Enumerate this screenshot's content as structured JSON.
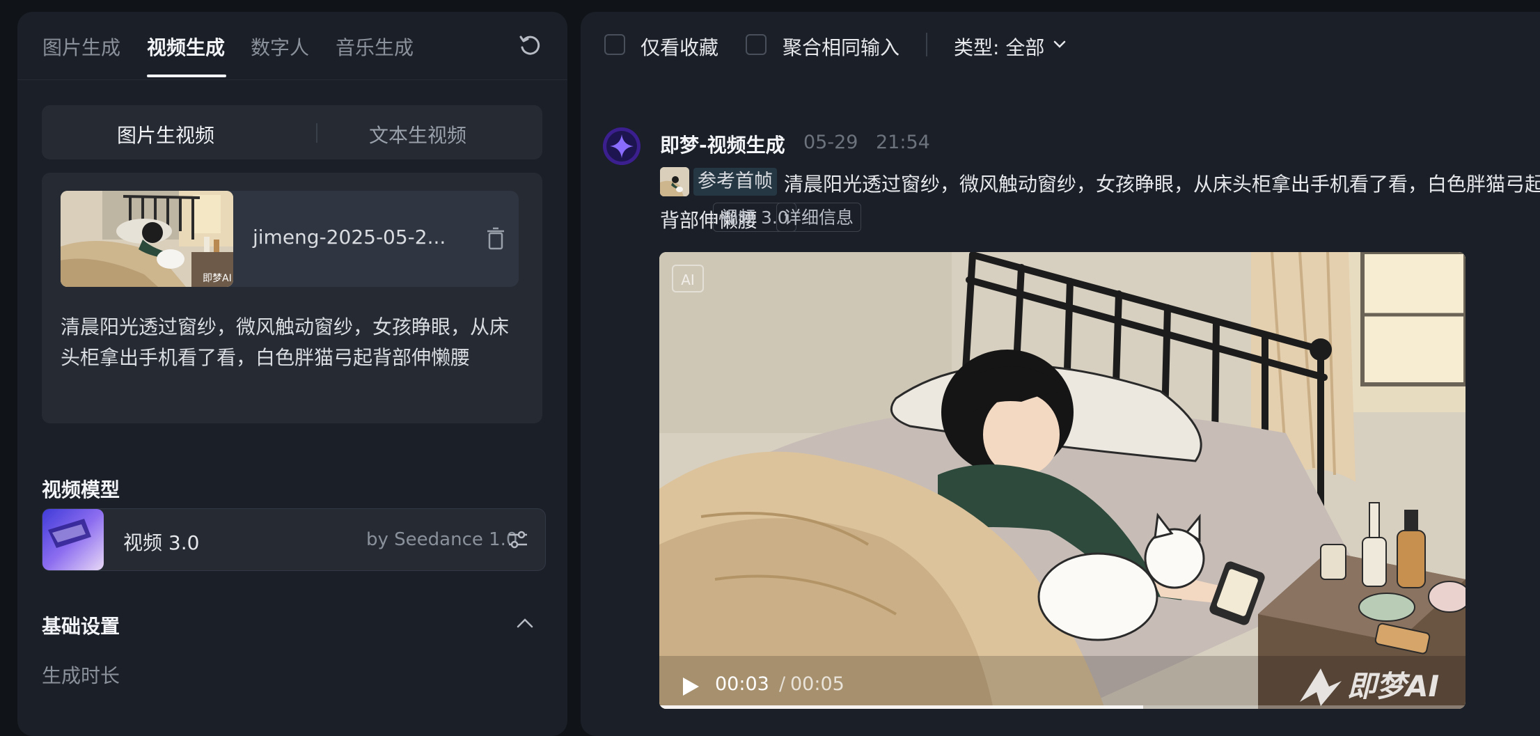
{
  "left": {
    "tabs": [
      {
        "label": "图片生成"
      },
      {
        "label": "视频生成"
      },
      {
        "label": "数字人"
      },
      {
        "label": "音乐生成"
      }
    ],
    "mode_tabs": [
      {
        "label": "图片生视频"
      },
      {
        "label": "文本生视频"
      }
    ],
    "input": {
      "file_name": "jimeng-2025-05-2...",
      "prompt": "清晨阳光透过窗纱，微风触动窗纱，女孩睁眼，从床头柜拿出手机看了看，白色胖猫弓起背部伸懒腰"
    },
    "model_section": {
      "title": "视频模型",
      "model_name": "视频 3.0",
      "model_by": "by Seedance 1.0"
    },
    "basic_settings": {
      "title": "基础设置",
      "duration_label": "生成时长"
    }
  },
  "right": {
    "filters": {
      "favorites_label": "仅看收藏",
      "merge_label": "聚合相同输入",
      "type_label": "类型: 全部"
    },
    "message": {
      "name": "即梦-视频生成",
      "date": "05-29",
      "time": "21:54",
      "ref_label": "参考首帧",
      "text": "清晨阳光透过窗纱，微风触动窗纱，女孩睁眼，从床头柜拿出手机看了看，白色胖猫弓起背部伸懒腰",
      "model_badge": "视频 3.0",
      "detail_badge": "详细信息"
    },
    "video": {
      "ai_mark": "AI",
      "current_time": "00:03",
      "separator": "/",
      "duration": "00:05",
      "progress": 0.6,
      "watermark": "即梦AI"
    }
  },
  "colors": {
    "accent_avatar": "#3b1f8e",
    "star": "#7b5cff",
    "panel": "#1b1f27",
    "background": "#101318"
  },
  "icons": [
    "refresh-icon",
    "trash-icon",
    "sliders-icon",
    "chevron-up-icon",
    "chevron-down-icon",
    "play-icon",
    "star-icon"
  ]
}
